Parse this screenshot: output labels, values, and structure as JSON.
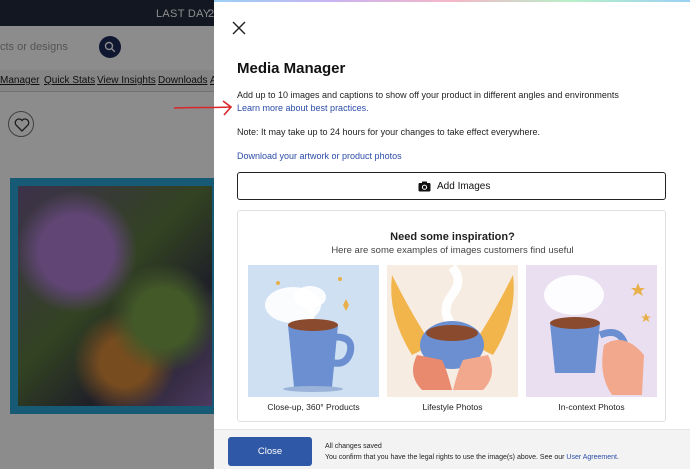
{
  "background": {
    "promo_text": "LAST DAY",
    "promo_extra": "2",
    "search_placeholder": "cts or designs",
    "nav_items": [
      "Manager",
      "Quick Stats",
      "View Insights",
      "Downloads",
      "A"
    ]
  },
  "modal": {
    "title": "Media Manager",
    "description": "Add up to 10 images and captions to show off your product in different angles and environments",
    "best_practices_link": "Learn more about best practices.",
    "note": "Note: It may take up to 24 hours for your changes to take effect everywhere.",
    "download_link": "Download your artwork or product photos",
    "add_images_label": "Add Images",
    "inspiration": {
      "title": "Need some inspiration?",
      "subtitle": "Here are some examples of images customers find useful",
      "cards": [
        {
          "caption": "Close-up, 360° Products",
          "bg": "#cfe0f3"
        },
        {
          "caption": "Lifestyle Photos",
          "bg": "#f6ece2"
        },
        {
          "caption": "In-context Photos",
          "bg": "#eadff0"
        }
      ]
    },
    "footer": {
      "close_label": "Close",
      "status": "All changes saved",
      "legal_prefix": "You confirm that you have the legal rights to use the image(s) above. See our ",
      "legal_link": "User Agreement",
      "legal_suffix": "."
    }
  },
  "icons": {
    "close": "close-icon",
    "camera": "camera-icon",
    "search": "search-icon",
    "heart": "heart-icon",
    "annotation_arrow": "red-arrow-icon"
  },
  "colors": {
    "accent": "#2f58a6",
    "link": "#2b4ca8",
    "arrow": "#d8262a",
    "topbar": "#232a3f"
  }
}
